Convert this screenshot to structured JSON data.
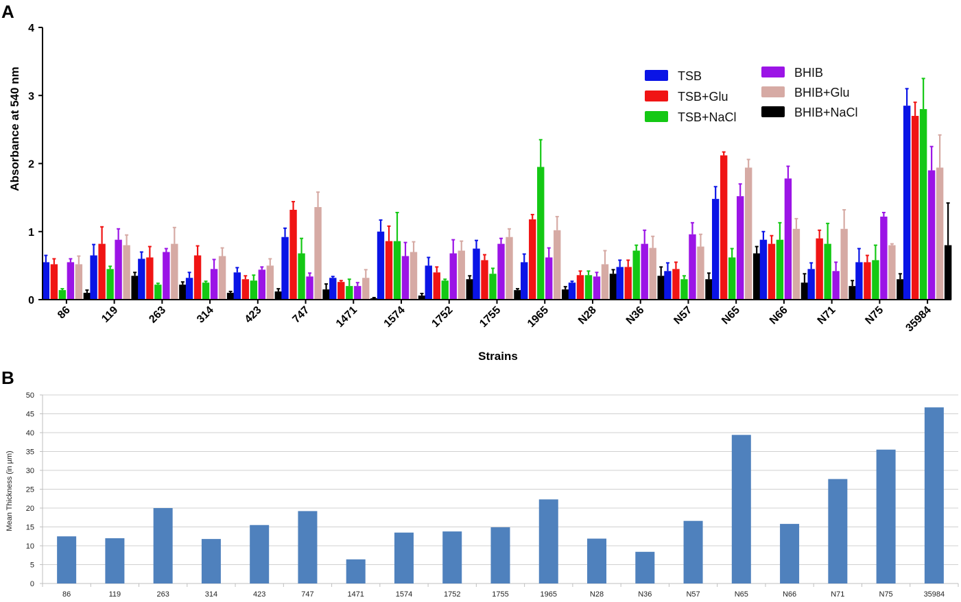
{
  "chart_data": [
    {
      "panel": "A",
      "type": "bar",
      "xlabel": "Strains",
      "ylabel": "Absorbance at 540 nm",
      "ylim": [
        0,
        4
      ],
      "yticks": [
        0,
        1,
        2,
        3,
        4
      ],
      "grid": false,
      "legend_position": "top-right",
      "categories": [
        "86",
        "119",
        "263",
        "314",
        "423",
        "747",
        "1471",
        "1574",
        "1752",
        "1755",
        "1965",
        "N28",
        "N36",
        "N57",
        "N65",
        "N66",
        "N71",
        "N75",
        "35984"
      ],
      "series": [
        {
          "name": "TSB",
          "color": "#0a14e6",
          "values": [
            0.55,
            0.65,
            0.6,
            0.32,
            0.4,
            0.92,
            0.32,
            1.0,
            0.5,
            0.75,
            0.55,
            0.25,
            0.48,
            0.42,
            1.48,
            0.88,
            0.45,
            0.55,
            2.85
          ],
          "errors": [
            0.1,
            0.16,
            0.1,
            0.08,
            0.07,
            0.13,
            0.02,
            0.17,
            0.12,
            0.12,
            0.12,
            0.02,
            0.1,
            0.12,
            0.18,
            0.12,
            0.09,
            0.2,
            0.25
          ]
        },
        {
          "name": "TSB+Glu",
          "color": "#f01414",
          "values": [
            0.52,
            0.82,
            0.62,
            0.65,
            0.3,
            1.32,
            0.26,
            0.86,
            0.4,
            0.58,
            1.18,
            0.36,
            0.48,
            0.45,
            2.12,
            0.82,
            0.9,
            0.55,
            2.7
          ],
          "errors": [
            0.08,
            0.25,
            0.16,
            0.14,
            0.05,
            0.12,
            0.02,
            0.22,
            0.08,
            0.08,
            0.07,
            0.06,
            0.1,
            0.1,
            0.05,
            0.12,
            0.12,
            0.1,
            0.2
          ]
        },
        {
          "name": "TSB+NaCl",
          "color": "#14c814",
          "values": [
            0.14,
            0.45,
            0.22,
            0.25,
            0.28,
            0.68,
            0.2,
            0.86,
            0.28,
            0.38,
            1.95,
            0.36,
            0.72,
            0.3,
            0.62,
            0.88,
            0.82,
            0.58,
            2.8
          ],
          "errors": [
            0.02,
            0.04,
            0.02,
            0.02,
            0.08,
            0.22,
            0.1,
            0.42,
            0.02,
            0.08,
            0.4,
            0.06,
            0.08,
            0.05,
            0.13,
            0.25,
            0.3,
            0.22,
            0.45
          ]
        },
        {
          "name": "BHIB",
          "color": "#9b14e6",
          "values": [
            0.55,
            0.88,
            0.7,
            0.45,
            0.44,
            0.34,
            0.2,
            0.64,
            0.68,
            0.82,
            0.62,
            0.34,
            0.82,
            0.96,
            1.52,
            1.78,
            0.42,
            1.22,
            1.9
          ],
          "errors": [
            0.05,
            0.16,
            0.05,
            0.14,
            0.04,
            0.05,
            0.05,
            0.2,
            0.2,
            0.08,
            0.14,
            0.06,
            0.2,
            0.17,
            0.18,
            0.18,
            0.13,
            0.06,
            0.35
          ]
        },
        {
          "name": "BHIB+Glu",
          "color": "#d6aaa4",
          "values": [
            0.52,
            0.8,
            0.82,
            0.64,
            0.5,
            1.36,
            0.32,
            0.7,
            0.72,
            0.92,
            1.02,
            0.52,
            0.76,
            0.78,
            1.94,
            1.04,
            1.04,
            0.8,
            1.94
          ],
          "errors": [
            0.12,
            0.15,
            0.24,
            0.12,
            0.1,
            0.22,
            0.12,
            0.15,
            0.14,
            0.12,
            0.2,
            0.2,
            0.17,
            0.18,
            0.12,
            0.15,
            0.28,
            0.02,
            0.48
          ]
        },
        {
          "name": "BHIB+NaCl",
          "color": "#000000",
          "values": [
            0.1,
            0.35,
            0.22,
            0.1,
            0.12,
            0.15,
            0.02,
            0.06,
            0.3,
            0.14,
            0.15,
            0.38,
            0.35,
            0.3,
            0.68,
            0.25,
            0.2,
            0.3,
            0.8
          ],
          "errors": [
            0.04,
            0.05,
            0.04,
            0.02,
            0.04,
            0.08,
            0.01,
            0.03,
            0.05,
            0.02,
            0.04,
            0.06,
            0.13,
            0.09,
            0.1,
            0.13,
            0.08,
            0.08,
            0.62
          ]
        }
      ]
    },
    {
      "panel": "B",
      "type": "bar",
      "xlabel": "",
      "ylabel": "Mean Thickness (in µm)",
      "ylim": [
        0,
        50
      ],
      "yticks": [
        0,
        5,
        10,
        15,
        20,
        25,
        30,
        35,
        40,
        45,
        50
      ],
      "grid": true,
      "categories": [
        "86",
        "119",
        "263",
        "314",
        "423",
        "747",
        "1471",
        "1574",
        "1752",
        "1755",
        "1965",
        "N28",
        "N36",
        "N57",
        "N65",
        "N66",
        "N71",
        "N75",
        "35984"
      ],
      "series": [
        {
          "color": "#4f81bd",
          "values": [
            12.5,
            12.0,
            20.0,
            11.8,
            15.5,
            19.2,
            6.4,
            13.5,
            13.8,
            14.9,
            22.3,
            11.9,
            8.4,
            16.6,
            39.4,
            15.8,
            27.7,
            35.5,
            46.7
          ]
        }
      ]
    }
  ]
}
